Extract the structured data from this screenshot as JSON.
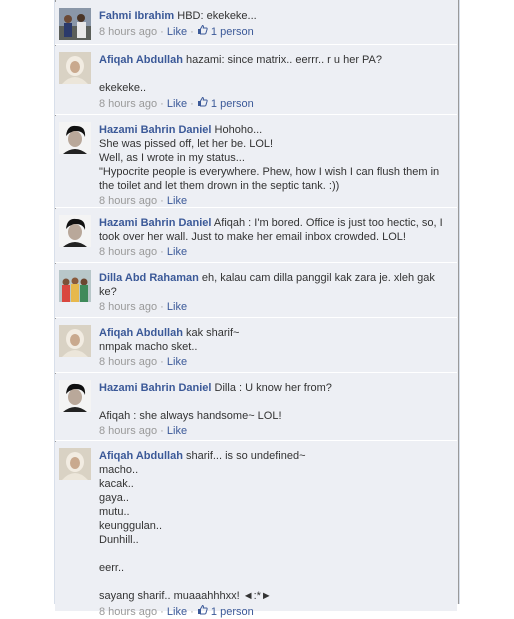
{
  "colors": {
    "link": "#3b5998",
    "meta": "#999999",
    "bg": "#edeff4"
  },
  "comments": [
    {
      "author": "Fahmi Ibrahim",
      "first": "HBD: ekekeke...",
      "rest": "",
      "time": "8 hours ago",
      "like": "Like",
      "likes": "1 person",
      "avatar": "group-photo"
    },
    {
      "author": "Afiqah Abdullah",
      "first": "hazami: since matrix.. eerrr.. r u her PA?",
      "rest": "\nekekeke..",
      "time": "8 hours ago",
      "like": "Like",
      "likes": "1 person",
      "avatar": "hijab"
    },
    {
      "author": "Hazami Bahrin Daniel",
      "first": "Hohoho...",
      "rest": "She was pissed off, let her be. LOL!\nWell, as I wrote in my status...\n\"Hypocrite people is everywhere. Phew, how I wish I can flush them in the toilet and let them drown in the septic tank. :))",
      "time": "8 hours ago",
      "like": "Like",
      "likes": "",
      "avatar": "man"
    },
    {
      "author": "Hazami Bahrin Daniel",
      "first": "Afiqah : I'm bored. Office is just too hectic, so, I took over her wall. Just to make her email inbox crowded. LOL!",
      "rest": "",
      "time": "8 hours ago",
      "like": "Like",
      "likes": "",
      "avatar": "man"
    },
    {
      "author": "Dilla Abd Rahaman",
      "first": "eh, kalau cam dilla panggil kak zara je. xleh gak ke?",
      "rest": "",
      "time": "8 hours ago",
      "like": "Like",
      "likes": "",
      "avatar": "group-color"
    },
    {
      "author": "Afiqah Abdullah",
      "first": "kak sharif~",
      "rest": "nmpak macho sket..",
      "time": "8 hours ago",
      "like": "Like",
      "likes": "",
      "avatar": "hijab"
    },
    {
      "author": "Hazami Bahrin Daniel",
      "first": "Dilla : U know her from?",
      "rest": "\nAfiqah : she always handsome~ LOL!",
      "time": "8 hours ago",
      "like": "Like",
      "likes": "",
      "avatar": "man"
    },
    {
      "author": "Afiqah Abdullah",
      "first": "sharif... is so undefined~",
      "rest": "macho..\nkacak..\ngaya..\nmutu..\nkeunggulan..\nDunhill..\n\neerr..\n\nsayang sharif.. muaaahhhxx! ◄:*►",
      "time": "8 hours ago",
      "like": "Like",
      "likes": "1 person",
      "avatar": "hijab"
    }
  ]
}
